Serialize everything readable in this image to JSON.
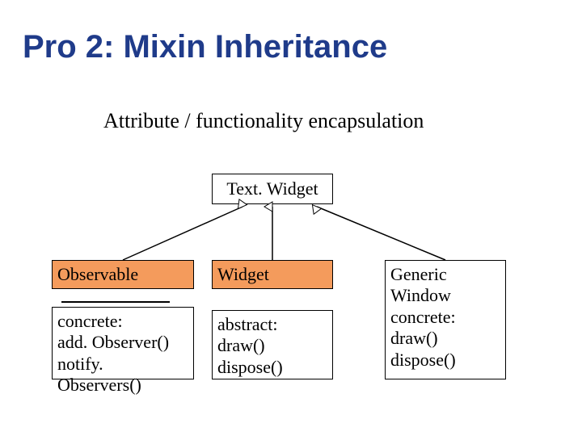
{
  "title": "Pro 2: Mixin Inheritance",
  "subtitle": "Attribute / functionality encapsulation",
  "boxes": {
    "textwidget": {
      "name": "Text. Widget"
    },
    "observable": {
      "name": "Observable",
      "methods": "concrete:\nadd. Observer()\nnotify. Observers()"
    },
    "widget": {
      "name": "Widget",
      "methods": "abstract:\ndraw()\ndispose()"
    },
    "generic": {
      "text": "Generic\nWindow\nconcrete:\ndraw()\ndispose()"
    }
  },
  "chart_data": {
    "type": "diagram",
    "title": "Pro 2: Mixin Inheritance",
    "subtitle": "Attribute / functionality encapsulation",
    "nodes": [
      {
        "id": "TextWidget",
        "label": "Text. Widget"
      },
      {
        "id": "Observable",
        "label": "Observable",
        "kind": "mixin",
        "methods": [
          "concrete:",
          "add. Observer()",
          "notify. Observers()"
        ]
      },
      {
        "id": "Widget",
        "label": "Widget",
        "kind": "mixin",
        "methods": [
          "abstract:",
          "draw()",
          "dispose()"
        ]
      },
      {
        "id": "GenericWindow",
        "label": "Generic Window",
        "methods": [
          "concrete:",
          "draw()",
          "dispose()"
        ]
      }
    ],
    "edges": [
      {
        "from": "Observable",
        "to": "TextWidget",
        "type": "inherits"
      },
      {
        "from": "Widget",
        "to": "TextWidget",
        "type": "inherits"
      },
      {
        "from": "GenericWindow",
        "to": "TextWidget",
        "type": "inherits"
      }
    ]
  }
}
